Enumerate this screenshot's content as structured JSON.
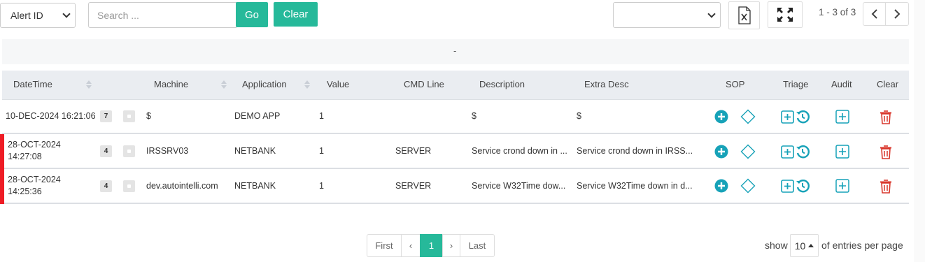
{
  "toolbar": {
    "filter_field": "Alert ID",
    "search_placeholder": "Search ...",
    "go_label": "Go",
    "clear_label": "Clear",
    "view_select_value": "",
    "range_text": "1 - 3 of 3"
  },
  "banner": {
    "text": "-"
  },
  "table": {
    "headers": {
      "datetime": "DateTime",
      "machine": "Machine",
      "application": "Application",
      "value": "Value",
      "cmd_line": "CMD Line",
      "description": "Description",
      "extra_desc": "Extra Desc",
      "sop": "SOP",
      "triage": "Triage",
      "audit": "Audit",
      "clear": "Clear"
    },
    "rows": [
      {
        "datetime_line1": "10-DEC-2024 16:21:06",
        "datetime_line2": "",
        "count": "7",
        "machine": "$",
        "application": "DEMO APP",
        "value": "1",
        "cmd_line": "",
        "description": "$",
        "extra_desc": "$",
        "flagged": false
      },
      {
        "datetime_line1": "28-OCT-2024",
        "datetime_line2": "14:27:08",
        "count": "4",
        "machine": "IRSSRV03",
        "application": "NETBANK",
        "value": "1",
        "cmd_line": "SERVER",
        "description": "Service crond down in ...",
        "extra_desc": "Service crond down in IRSS...",
        "flagged": true
      },
      {
        "datetime_line1": "28-OCT-2024",
        "datetime_line2": "14:25:36",
        "count": "4",
        "machine": "dev.autointelli.com",
        "application": "NETBANK",
        "value": "1",
        "cmd_line": "SERVER",
        "description": "Service W32Time dow...",
        "extra_desc": "Service W32Time down in d...",
        "flagged": true
      }
    ]
  },
  "pagination": {
    "first": "First",
    "prev": "‹",
    "current": "1",
    "next": "›",
    "last": "Last",
    "show_label": "show",
    "page_size": "10",
    "suffix": "of entries per page"
  },
  "colors": {
    "accent": "#26b99a",
    "icon_teal": "#17a2b8",
    "danger": "#d9362b",
    "flag": "#ee1c25"
  }
}
